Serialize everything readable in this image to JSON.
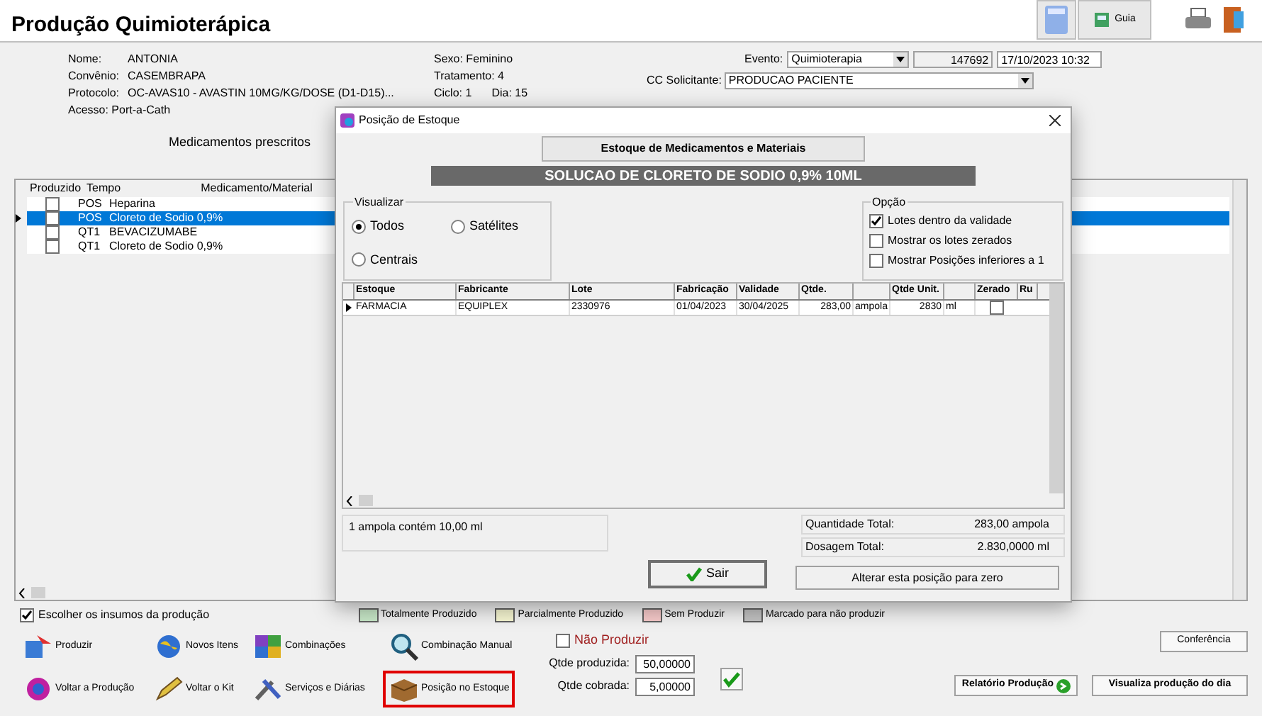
{
  "title": "Produção Quimioterápica",
  "toolbar": {
    "guide": "Guia"
  },
  "patient": [
    {
      "label": "Nome:",
      "value": "ANTONIA"
    },
    {
      "label": "Convênio:",
      "value": "CASEMBRAPA"
    },
    {
      "label": "Protocolo:",
      "value": "OC-AVAS10 - AVASTIN 10MG/KG/DOSE (D1-D15)..."
    }
  ],
  "access": "Acesso: Port-a-Cath",
  "details": [
    "Sexo: Feminino",
    "Tratamento: 4"
  ],
  "cycle": [
    "Ciclo: 1",
    "Dia: 15"
  ],
  "event": {
    "label": "Evento:",
    "value": "Quimioterapia",
    "number": "147692",
    "datetime": "17/10/2023 10:32"
  },
  "requester": {
    "label": "CC Solicitante:",
    "value": "PRODUCAO PACIENTE"
  },
  "section_label": "Medicamentos prescritos",
  "grid": {
    "columns": [
      "Produzido",
      "Tempo",
      "Medicamento/Material"
    ],
    "rows": [
      {
        "checked": false,
        "time": "POS",
        "item": "Heparina",
        "selected": false
      },
      {
        "checked": false,
        "time": "POS",
        "item": "Cloreto de Sodio 0,9%",
        "selected": true
      },
      {
        "checked": false,
        "time": "QT1",
        "item": "BEVACIZUMABE",
        "selected": false
      },
      {
        "checked": false,
        "time": "QT1",
        "item": "Cloreto de Sodio 0,9%",
        "selected": false
      }
    ]
  },
  "dialog": {
    "title": "Posição de Estoque",
    "header_button": "Estoque de Medicamentos e Materiais",
    "product": "SOLUCAO DE CLORETO DE SODIO 0,9% 10ML",
    "view": {
      "title": "Visualizar",
      "options": [
        {
          "label": "Todos",
          "selected": true
        },
        {
          "label": "Satélites",
          "selected": false
        },
        {
          "label": "Centrais",
          "selected": false
        }
      ]
    },
    "option": {
      "title": "Opção",
      "checks": [
        {
          "label": "Lotes dentro da validade",
          "checked": true
        },
        {
          "label": "Mostrar os lotes zerados",
          "checked": false
        },
        {
          "label": "Mostrar Posições inferiores a 1",
          "checked": false
        }
      ]
    },
    "table": {
      "columns": [
        {
          "label": "Estoque"
        },
        {
          "label": "Fabricante"
        },
        {
          "label": "Lote"
        },
        {
          "label": "Fabricação"
        },
        {
          "label": "Validade"
        },
        {
          "label": "Qtde."
        },
        {},
        {
          "label": "Qtde Unit."
        },
        {},
        {
          "label": "Zerado"
        },
        {
          "label": "Ru"
        }
      ],
      "rows": [
        {
          "cells": [
            "FARMACIA",
            "EQUIPLEX",
            "2330976",
            "01/04/2023",
            "30/04/2025",
            "283,00",
            "ampola",
            "2830",
            "ml"
          ],
          "zeroed": false,
          "selected": true
        }
      ]
    },
    "info": "1 ampola contém 10,00 ml",
    "totals": [
      {
        "label": "Quantidade Total:",
        "value": "283,00 ampola"
      },
      {
        "label": "Dosagem Total:",
        "value": "2.830,0000 ml"
      }
    ],
    "exit_button": "Sair",
    "zero_button": "Alterar esta posição para zero"
  },
  "choose_inputs": {
    "label": "Escolher os insumos da produção",
    "checked": true
  },
  "legend": [
    {
      "label": "Totalmente Produzido",
      "color": "#c6e6c6"
    },
    {
      "label": "Parcialmente Produzido",
      "color": "#f5f5d0"
    },
    {
      "label": "Sem Produzir",
      "color": "#f5c8c8"
    },
    {
      "label": "Marcado para não produzir",
      "color": "#c0c0c0"
    }
  ],
  "actions": [
    {
      "label": "Produzir",
      "highlighted": false
    },
    {
      "label": "Novos Itens",
      "highlighted": false
    },
    {
      "label": "Combinações",
      "highlighted": false
    },
    {
      "label": "Combinação Manual",
      "highlighted": false
    },
    {
      "label": "Voltar a Produção",
      "highlighted": false
    },
    {
      "label": "Voltar o Kit",
      "highlighted": false
    },
    {
      "label": "Serviços e Diárias",
      "highlighted": false
    },
    {
      "label": "Posição no Estoque",
      "highlighted": true
    }
  ],
  "no_produce": {
    "label": "Não Produzir",
    "checked": false
  },
  "qty_produced": {
    "label": "Qtde produzida:",
    "value": "50,00000"
  },
  "qty_charged": {
    "label": "Qtde cobrada:",
    "value": "5,00000"
  },
  "conference_button": "Conferência",
  "report_button": "Relatório Produção",
  "daily_button": "Visualiza produção do dia"
}
